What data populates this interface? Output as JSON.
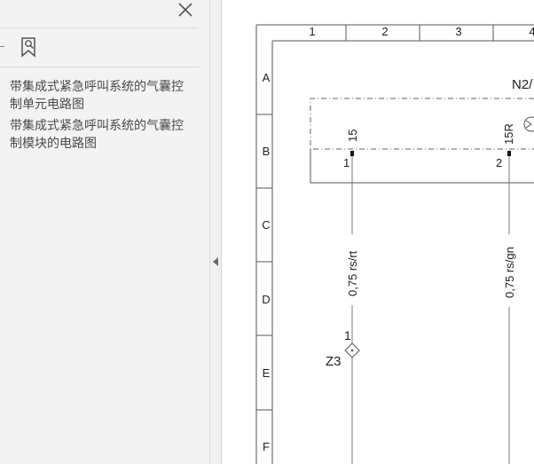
{
  "panel": {
    "close_icon": "close-icon",
    "bookmark_icon": "bookmark-search-icon",
    "bookmarks": [
      {
        "label": "带集成式紧急呼叫系统的气囊控制单元电路图"
      },
      {
        "label": "带集成式紧急呼叫系统的气囊控制模块的电路图"
      }
    ]
  },
  "splitter": {
    "icon": "collapse-left-arrow-icon"
  },
  "diagram": {
    "columns": [
      "1",
      "2",
      "3",
      "4"
    ],
    "rows": [
      "A",
      "B",
      "C",
      "D",
      "E",
      "F"
    ],
    "component_label": "N2/",
    "pins": [
      {
        "name": "15",
        "number": "1"
      },
      {
        "name": "15R",
        "number": "2"
      }
    ],
    "wires": [
      {
        "label": "0,75 rs/rt"
      },
      {
        "label": "0,75 rs/gn"
      }
    ],
    "connector": {
      "label": "Z3",
      "pin": "1"
    }
  }
}
